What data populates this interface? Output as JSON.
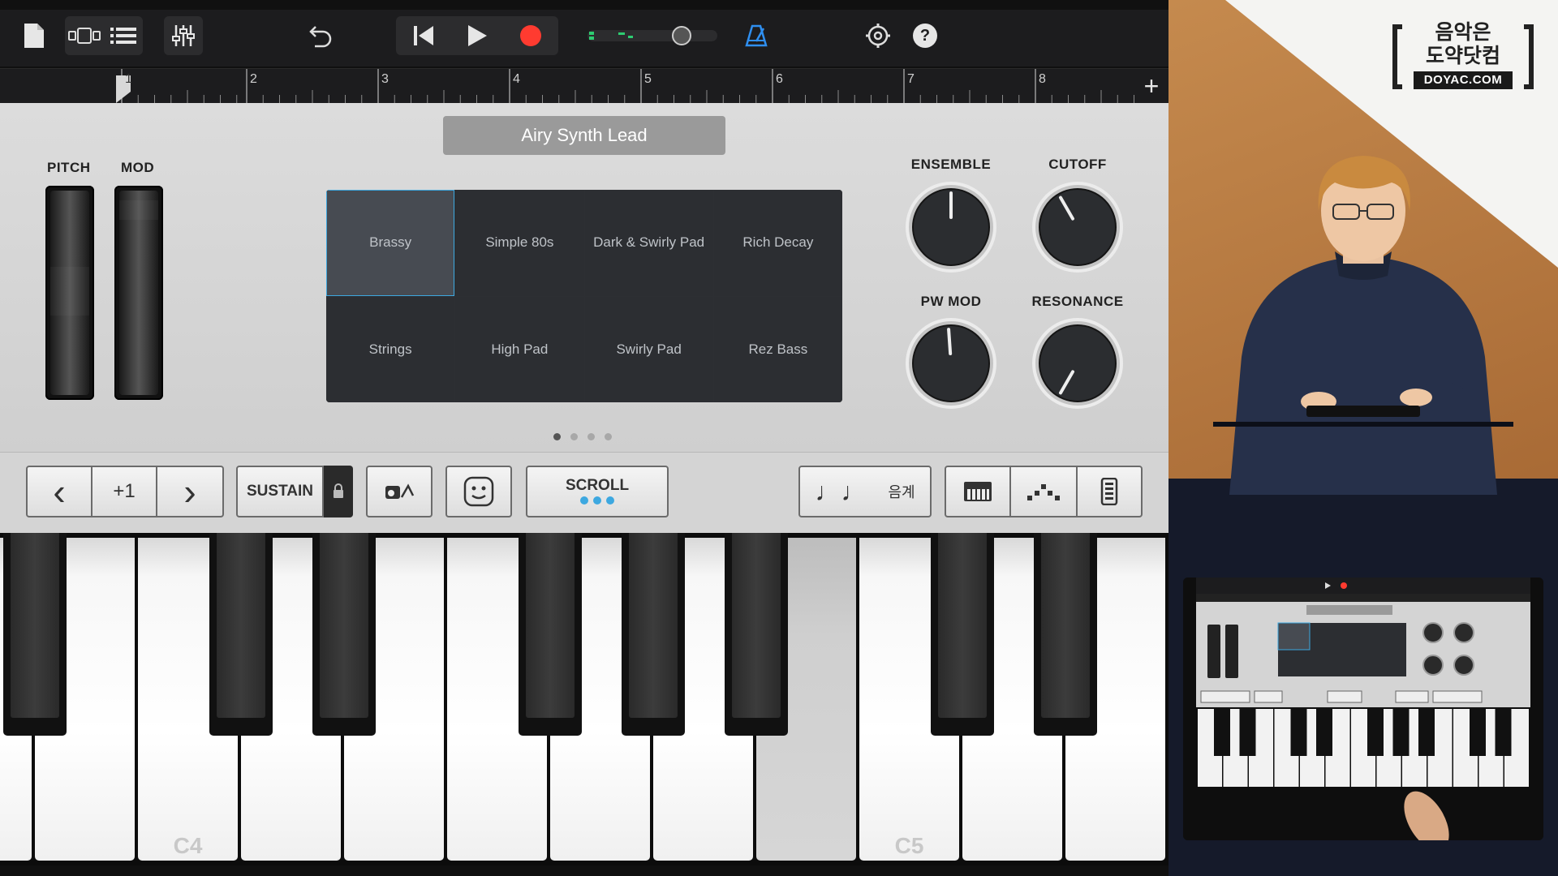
{
  "toolbar": {
    "icons": [
      "document-icon",
      "tracks-view-icon",
      "list-view-icon",
      "mixer-icon",
      "undo-icon",
      "rewind-icon",
      "play-icon",
      "record-icon",
      "volume-slider",
      "metronome-icon",
      "settings-icon",
      "help-icon"
    ],
    "help_label": "?"
  },
  "ruler": {
    "bars": [
      "1",
      "2",
      "3",
      "4",
      "5",
      "6",
      "7",
      "8"
    ],
    "add_label": "+"
  },
  "instrument": {
    "patch_name": "Airy Synth Lead",
    "wheels": {
      "pitch_label": "PITCH",
      "mod_label": "MOD"
    },
    "patches": [
      {
        "label": "Brassy",
        "selected": true
      },
      {
        "label": "Simple 80s"
      },
      {
        "label": "Dark & Swirly Pad"
      },
      {
        "label": "Rich Decay"
      },
      {
        "label": "Strings"
      },
      {
        "label": "High Pad"
      },
      {
        "label": "Swirly Pad"
      },
      {
        "label": "Rez Bass"
      }
    ],
    "page_count": 4,
    "page_active": 1,
    "knobs": {
      "ensemble": {
        "label": "ENSEMBLE",
        "angle_deg": 0
      },
      "cutoff": {
        "label": "CUTOFF",
        "angle_deg": -30
      },
      "pw_mod": {
        "label": "PW MOD",
        "angle_deg": -4
      },
      "resonance": {
        "label": "RESONANCE",
        "angle_deg": -150
      }
    }
  },
  "controls": {
    "octave_down": "‹",
    "octave_value": "+1",
    "octave_up": "›",
    "sustain_label": "SUSTAIN",
    "scroll_label": "SCROLL",
    "scale_label": "음계",
    "scale_icon": "♩♩"
  },
  "keyboard": {
    "labels": {
      "c4": "C4",
      "c5": "C5"
    }
  },
  "overlay": {
    "logo_line1": "음악은",
    "logo_line2": "도약닷컴",
    "logo_en": "DOYAC.COM"
  },
  "colors": {
    "accent_blue": "#3da8e0",
    "record_red": "#ff3b30",
    "toolbar_bg": "#1c1c1e",
    "panel_bg": "#d6d6d6",
    "metronome_blue": "#2f8ff0",
    "level_green": "#2ecc71"
  }
}
